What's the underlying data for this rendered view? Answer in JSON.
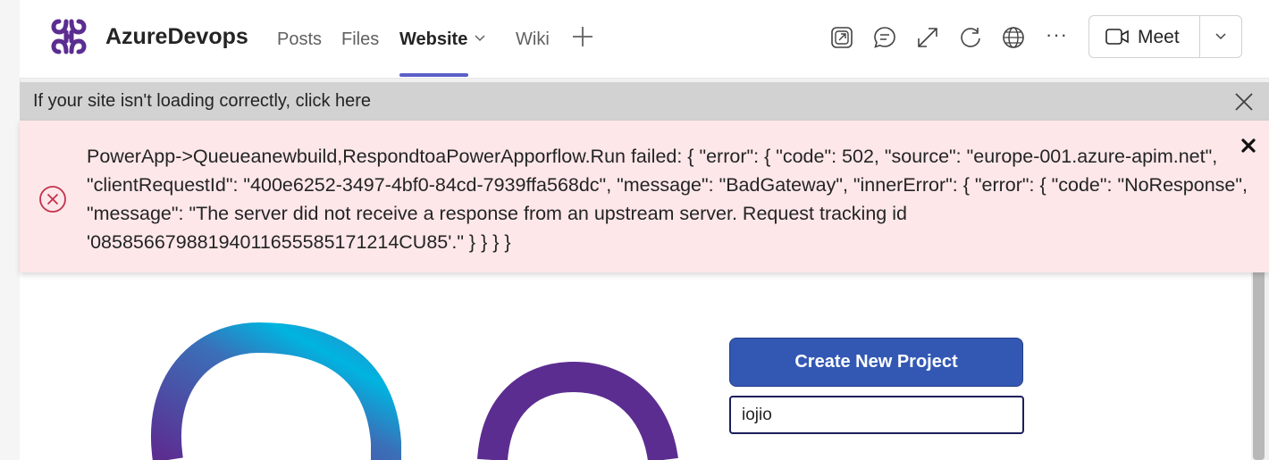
{
  "app": {
    "title": "AzureDevops",
    "logo_icon": "azure-devops-team-logo"
  },
  "tabs": [
    {
      "label": "Posts",
      "active": false
    },
    {
      "label": "Files",
      "active": false
    },
    {
      "label": "Website",
      "active": true,
      "has_dropdown": true
    },
    {
      "label": "Wiki",
      "active": false
    }
  ],
  "header_icons": [
    "popout-icon",
    "chat-icon",
    "expand-icon",
    "reload-icon",
    "globe-icon",
    "more-icon"
  ],
  "meet": {
    "label": "Meet"
  },
  "notice": {
    "text": "If your site isn't loading correctly, click here"
  },
  "error": {
    "message": "PowerApp->Queueanewbuild,RespondtoaPowerApporflow.Run failed: { \"error\": { \"code\": 502, \"source\": \"europe-001.azure-apim.net\", \"clientRequestId\": \"400e6252-3497-4bf0-84cd-7939ffa568dc\", \"message\": \"BadGateway\", \"innerError\": { \"error\": { \"code\": \"NoResponse\", \"message\": \"The server did not receive a response from an upstream server. Request tracking id '08585667988194011655585171214CU85'.\" } } } }"
  },
  "site": {
    "create_button": "Create New Project",
    "project_input_value": "iojio"
  },
  "colors": {
    "accent": "#5b5fc7",
    "error_bg": "#fde7e9",
    "error_icon": "#c4314b",
    "button": "#3358b3",
    "logo_purple": "#5c2d91",
    "logo_cyan": "#00b4e0"
  }
}
